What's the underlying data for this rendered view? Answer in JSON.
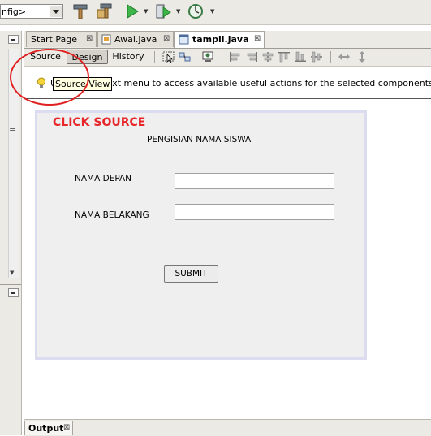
{
  "toolbar": {
    "config_value": "nfig>",
    "icons": [
      "clean-build-icon",
      "build-icon",
      "run-icon",
      "debug-icon",
      "profile-icon"
    ]
  },
  "editor_tabs": [
    {
      "label": "Start Page",
      "close": "⊠",
      "active": false
    },
    {
      "label": "Awal.java",
      "close": "⊠",
      "active": false
    },
    {
      "label": "tampil.java",
      "close": "⊠",
      "active": true
    }
  ],
  "view_tabs": {
    "source": "Source",
    "design": "Design",
    "history": "History"
  },
  "hint": {
    "text": "Use the context menu to access available useful actions for the selected components.",
    "tooltip": "Source View"
  },
  "annotation": {
    "text": "CLICK SOURCE",
    "color": "#e8262a"
  },
  "form": {
    "title": "PENGISIAN NAMA SISWA",
    "first_name_label": "NAMA DEPAN",
    "first_name_value": "",
    "last_name_label": "NAMA BELAKANG",
    "last_name_value": "",
    "submit_label": "SUBMIT"
  },
  "bottom": {
    "output_label": "Output",
    "output_close": "⊠"
  },
  "side": {
    "grip": "≡",
    "arrow_down": "▼"
  }
}
